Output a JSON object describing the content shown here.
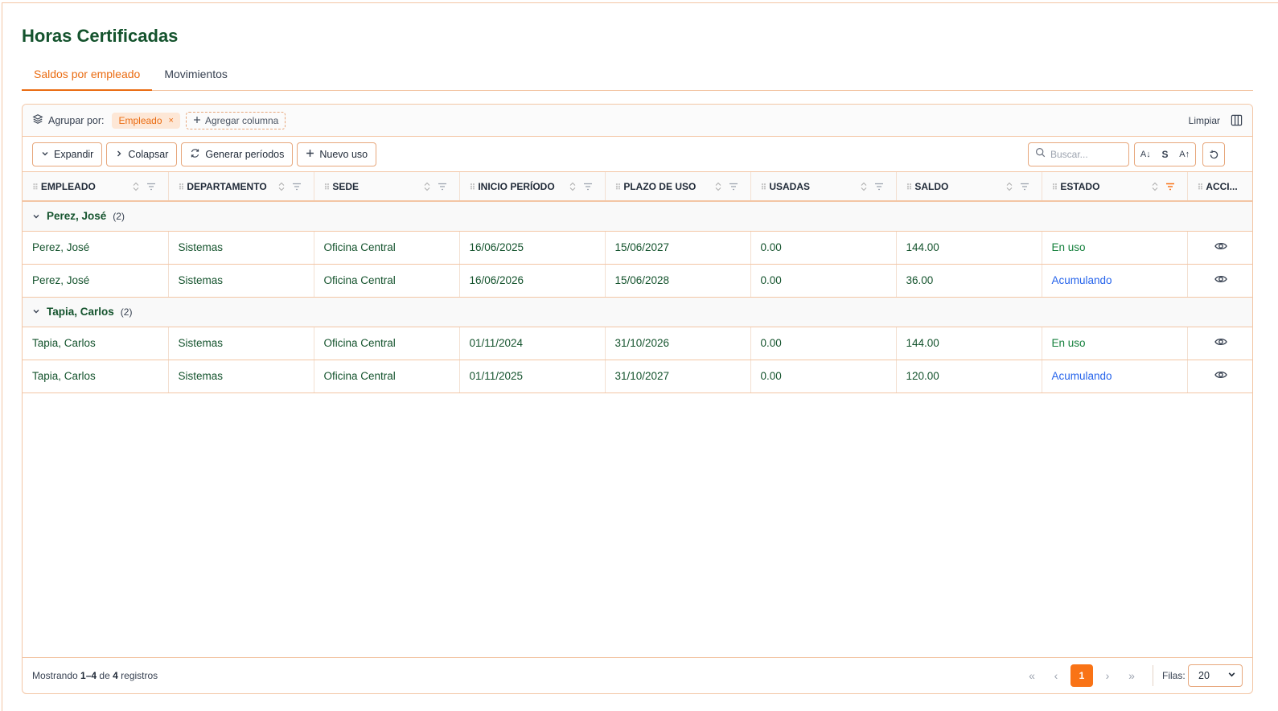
{
  "page": {
    "title": "Horas Certificadas"
  },
  "tabs": [
    {
      "label": "Saldos por empleado",
      "active": true
    },
    {
      "label": "Movimientos",
      "active": false
    }
  ],
  "group_bar": {
    "label": "Agrupar por:",
    "chip": "Empleado",
    "chip_remove": "×",
    "add_column": "Agregar columna",
    "clear": "Limpiar"
  },
  "toolbar": {
    "expand": "Expandir",
    "collapse": "Colapsar",
    "generate": "Generar períodos",
    "new_use": "Nuevo uso",
    "search_placeholder": "Buscar...",
    "size_small": "A↓",
    "size_medium": "S",
    "size_large": "A↑"
  },
  "columns": [
    "EMPLEADO",
    "DEPARTAMENTO",
    "SEDE",
    "INICIO PERÍODO",
    "PLAZO DE USO",
    "USADAS",
    "SALDO",
    "ESTADO",
    "ACCI..."
  ],
  "groups": [
    {
      "name": "Perez, José",
      "count": "(2)",
      "rows": [
        {
          "empleado": "Perez, José",
          "departamento": "Sistemas",
          "sede": "Oficina Central",
          "inicio": "16/06/2025",
          "plazo": "15/06/2027",
          "usadas": "0.00",
          "saldo": "144.00",
          "estado": "En uso"
        },
        {
          "empleado": "Perez, José",
          "departamento": "Sistemas",
          "sede": "Oficina Central",
          "inicio": "16/06/2026",
          "plazo": "15/06/2028",
          "usadas": "0.00",
          "saldo": "36.00",
          "estado": "Acumulando"
        }
      ]
    },
    {
      "name": "Tapia, Carlos",
      "count": "(2)",
      "rows": [
        {
          "empleado": "Tapia, Carlos",
          "departamento": "Sistemas",
          "sede": "Oficina Central",
          "inicio": "01/11/2024",
          "plazo": "31/10/2026",
          "usadas": "0.00",
          "saldo": "144.00",
          "estado": "En uso"
        },
        {
          "empleado": "Tapia, Carlos",
          "departamento": "Sistemas",
          "sede": "Oficina Central",
          "inicio": "01/11/2025",
          "plazo": "31/10/2027",
          "usadas": "0.00",
          "saldo": "120.00",
          "estado": "Acumulando"
        }
      ]
    }
  ],
  "footer": {
    "showing_prefix": "Mostrando",
    "range": "1–4",
    "of": "de",
    "total": "4",
    "suffix": "registros",
    "current_page": "1",
    "rows_label": "Filas:",
    "rows_value": "20"
  },
  "colors": {
    "accent": "#f97316",
    "title": "#14532d",
    "status_in_use": "#15803d",
    "status_accumulating": "#2563eb"
  }
}
